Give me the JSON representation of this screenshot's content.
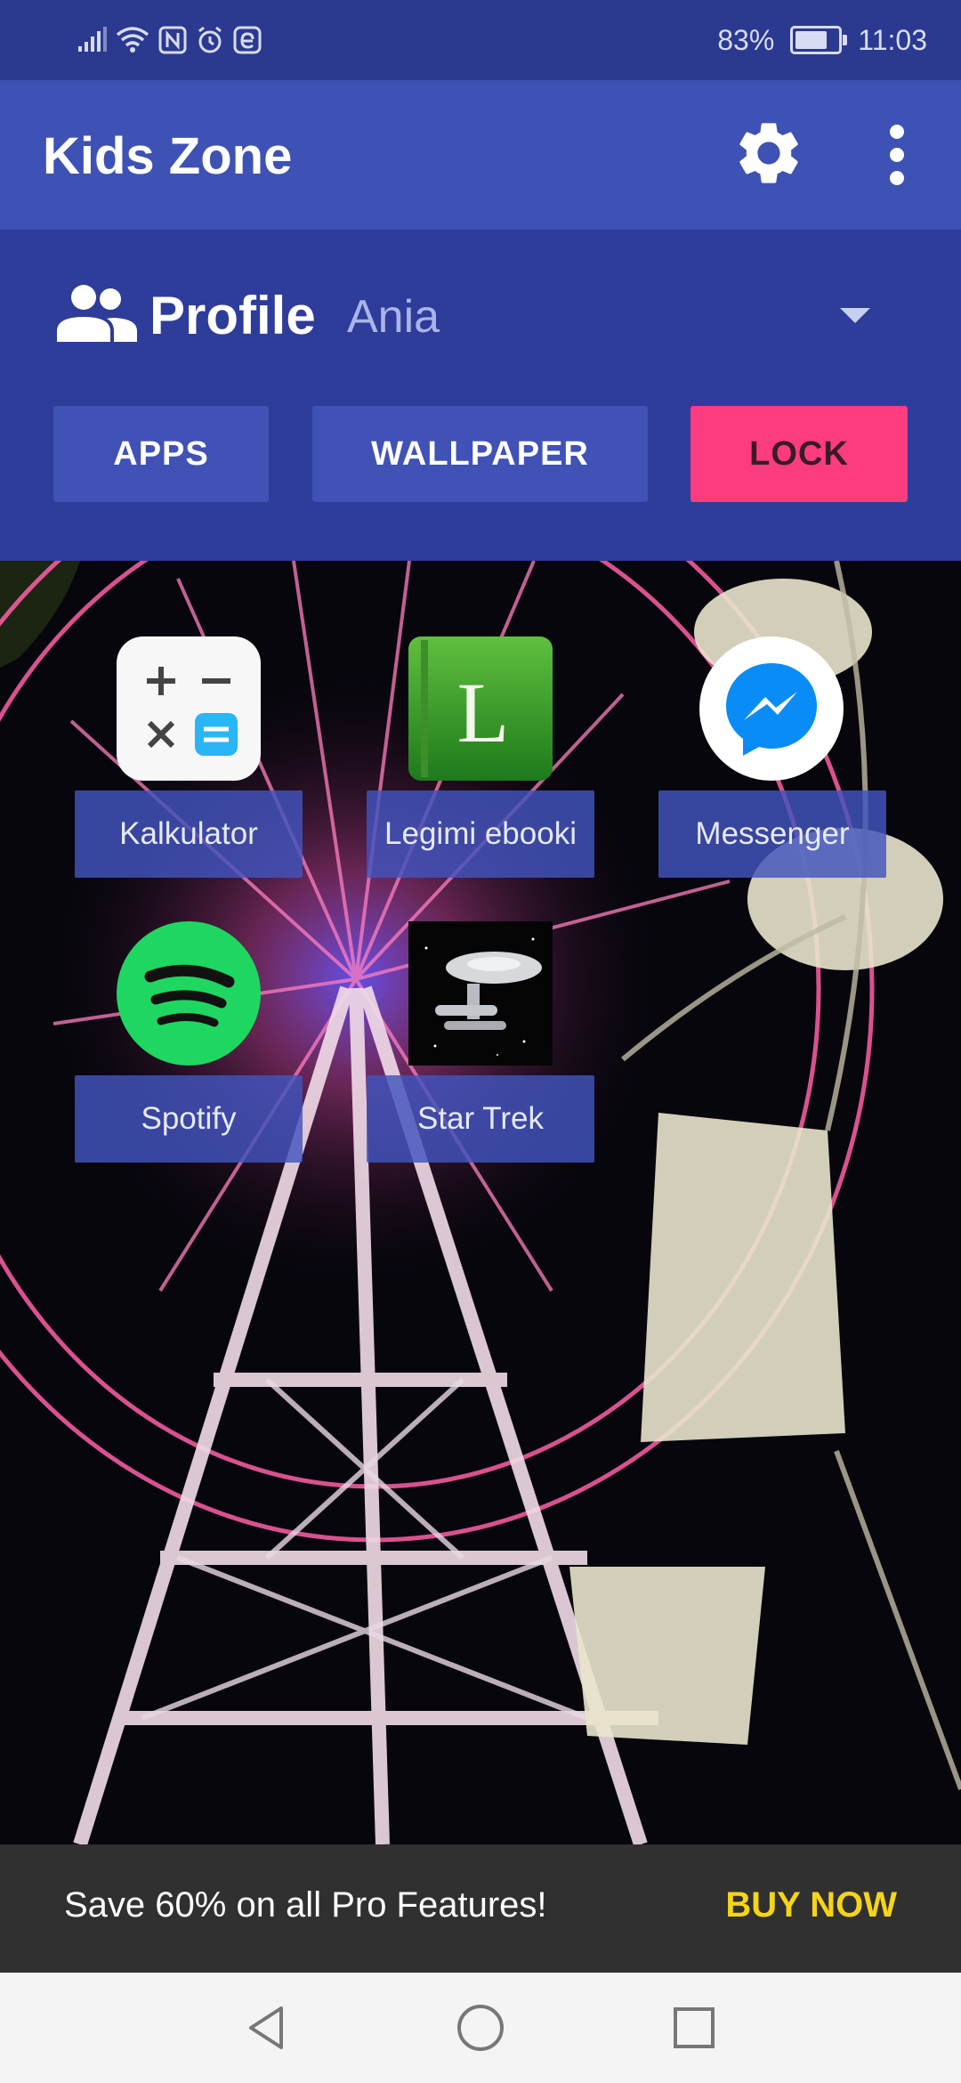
{
  "status_bar": {
    "battery_percent": "83%",
    "battery_level": 0.83,
    "time": "11:03",
    "icons": [
      "signal-icon",
      "wifi-icon",
      "nfc-icon",
      "alarm-icon",
      "e-icon"
    ]
  },
  "app_bar": {
    "title": "Kids Zone",
    "settings_icon": "gear-icon",
    "more_icon": "more-vert-icon"
  },
  "profile": {
    "label": "Profile",
    "value": "Ania",
    "icon": "people-icon"
  },
  "buttons": {
    "apps": "APPS",
    "wallpaper": "WALLPAPER",
    "lock": "LOCK"
  },
  "apps": [
    {
      "label": "Kalkulator",
      "icon": "calculator-icon"
    },
    {
      "label": "Legimi ebooki",
      "icon": "legimi-icon"
    },
    {
      "label": "Messenger",
      "icon": "messenger-icon"
    },
    {
      "label": "Spotify",
      "icon": "spotify-icon"
    },
    {
      "label": "Star Trek",
      "icon": "star-trek-icon"
    }
  ],
  "promo": {
    "text": "Save 60% on all Pro Features!",
    "action": "BUY NOW"
  },
  "nav": {
    "back_icon": "back-icon",
    "home_icon": "home-icon",
    "recents_icon": "recents-icon"
  },
  "colors": {
    "status_bar": "#2c3990",
    "app_bar": "#3e51b5",
    "profile_panel": "#2e3c9a",
    "button": "#4052b6",
    "lock_button": "#fd3b7f",
    "promo_bg": "#303030",
    "promo_action": "#f6d418"
  }
}
